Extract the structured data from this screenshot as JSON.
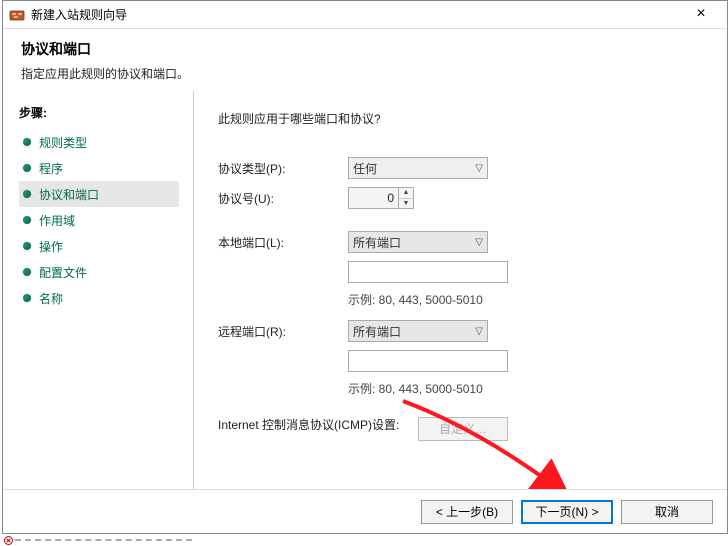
{
  "window": {
    "title": "新建入站规则向导"
  },
  "header": {
    "heading": "协议和端口",
    "subtitle": "指定应用此规则的协议和端口。"
  },
  "sidebar": {
    "title": "步骤:",
    "items": [
      {
        "label": "规则类型"
      },
      {
        "label": "程序"
      },
      {
        "label": "协议和端口"
      },
      {
        "label": "作用域"
      },
      {
        "label": "操作"
      },
      {
        "label": "配置文件"
      },
      {
        "label": "名称"
      }
    ],
    "active_index": 2
  },
  "content": {
    "question": "此规则应用于哪些端口和协议?",
    "protocol_type_label": "协议类型(P):",
    "protocol_type_value": "任何",
    "protocol_number_label": "协议号(U):",
    "protocol_number_value": "0",
    "local_port_label": "本地端口(L):",
    "local_port_value": "所有端口",
    "local_port_text": "",
    "local_port_example": "示例: 80, 443, 5000-5010",
    "remote_port_label": "远程端口(R):",
    "remote_port_value": "所有端口",
    "remote_port_text": "",
    "remote_port_example": "示例: 80, 443, 5000-5010",
    "icmp_label": "Internet 控制消息协议(ICMP)设置:",
    "customize_button": "自定义…"
  },
  "footer": {
    "back": "< 上一步(B)",
    "next": "下一页(N) >",
    "cancel": "取消"
  }
}
